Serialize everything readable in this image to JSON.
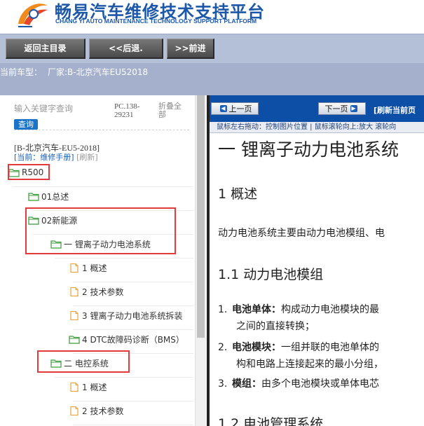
{
  "header": {
    "title_cn": "畅易汽车维修技术支持平台",
    "title_en": "CHANG YI AUTO MAINTENANCE TECHNOLOGY SUPPORT PLATFORM"
  },
  "toolbar": {
    "home_label": "返回主目录",
    "back_label": "<<后退.",
    "forward_label": ">>前进"
  },
  "model_bar": {
    "label": "当前车型：",
    "value": "厂家:B-北京汽车EU52018"
  },
  "left_panel": {
    "search_placeholder": "输入关键字查询",
    "search_button": "查询",
    "pc_code": "PC.138-29231",
    "collapse_all": "折叠全部",
    "book_title": "[B-北京汽车-EU5-2018]",
    "current_label": "[当前：维修手册]",
    "refresh_label": "[刷新]",
    "tree": [
      {
        "label": "R500",
        "type": "folder"
      },
      {
        "label": "01总述",
        "type": "folder"
      },
      {
        "label": "02新能源",
        "type": "folder"
      },
      {
        "label": "一 锂离子动力电池系统",
        "type": "folder"
      },
      {
        "label": "1 概述",
        "type": "page"
      },
      {
        "label": "2 技术参数",
        "type": "page"
      },
      {
        "label": "3 锂离子动力电池系统拆装",
        "type": "page"
      },
      {
        "label": "4 DTC故障码诊断（BMS）",
        "type": "folder"
      },
      {
        "label": "二 电控系统",
        "type": "folder"
      },
      {
        "label": "1 概述",
        "type": "page"
      },
      {
        "label": "2 技术参数",
        "type": "page"
      }
    ]
  },
  "right_panel": {
    "prev_label": "上一页",
    "next_label": "下一页",
    "refresh_label": "[刷新当前页",
    "hint": "鼠标左右拖动：控制图片位置 | 鼠标滚轮向上:放大  滚轮向",
    "doc": {
      "title": "一 锂离子动力电池系统",
      "h_overview": "1 概述",
      "p_overview": "动力电池系统主要由动力电池模组、电",
      "h_module": "1.1 动力电池模组",
      "items": [
        {
          "num": "1.",
          "term": "电池单体：",
          "text": "构成动力电池模块的最",
          "cont": "之间的直接转换；"
        },
        {
          "num": "2.",
          "term": "电池模块：",
          "text": "一组并联的电池单体的",
          "cont": "构和电路上连接起来的最小分组，"
        },
        {
          "num": "3.",
          "term": "模组：",
          "text": "由多个电池模块或单体电芯",
          "cont": ""
        }
      ],
      "h_bms": "1.2 电池管理系统"
    }
  },
  "colors": {
    "brand_blue": "#1d57a8",
    "toolbar_bg": "#b4bfd8",
    "nav_bar_bg": "#0d4ea6",
    "highlight_red": "#e23b3b",
    "folder_green": "#3a9a3a",
    "page_orange": "#e8a33c"
  }
}
